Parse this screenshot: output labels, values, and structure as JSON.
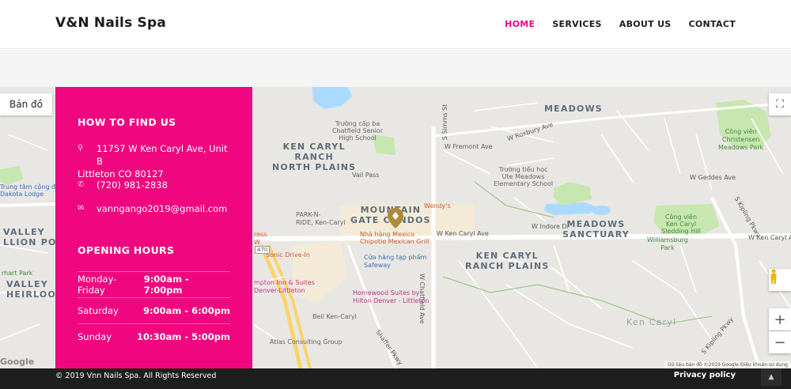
{
  "brand": "V&N Nails Spa",
  "nav": {
    "items": [
      "HOME",
      "SERVICES",
      "ABOUT US",
      "CONTACT"
    ]
  },
  "find": {
    "title": "HOW TO FIND US",
    "address_line1": "11757 W Ken Caryl Ave, Unit B",
    "address_line2": "Littleton CO 80127",
    "phone": "(720) 981-2838",
    "email": "vanngango2019@gmail.com"
  },
  "hours": {
    "title": "OPENING HOURS",
    "rows": [
      {
        "day": "Monday-Friday",
        "time": "9:00am - 7:00pm"
      },
      {
        "day": "Saturday",
        "time": "9:00am - 6:00pm"
      },
      {
        "day": "Sunday",
        "time": "10:30am - 5:00pm"
      }
    ]
  },
  "map": {
    "type_button": "Bản đồ",
    "areas": {
      "meadows": "MEADOWS",
      "ken_caryl_north_1": "KEN CARYL",
      "ken_caryl_north_2": "RANCH",
      "ken_caryl_north_3": "NORTH PLAINS",
      "mountain_gate_1": "MOUNTAIN",
      "mountain_gate_2": "GATE CONDOS",
      "meadows_sanctuary_1": "MEADOWS",
      "meadows_sanctuary_2": "SANCTUARY",
      "ranch_plains_1": "KEN CARYL",
      "ranch_plains_2": "RANCH PLAINS",
      "valley_lion_1": "VALLEY",
      "valley_lion_2": "LLION POIN",
      "valley_heirloom_1": "VALLEY",
      "valley_heirloom_2": "HEIRLOOM",
      "ken_caryl_faint": "Ken Caryl"
    },
    "pois": {
      "school_high_1": "Trường cấp ba",
      "school_high_2": "Chatfield Senior",
      "school_high_3": "High School",
      "school_elem_1": "Trường tiểu học",
      "school_elem_2": "Ute Meadows",
      "school_elem_3": "Elementary School",
      "park_christensen_1": "Công viên",
      "park_christensen_2": "Christensen",
      "park_christensen_3": "Meadows Park",
      "park_sledding_1": "Công viên",
      "park_sledding_2": "Ken Caryl",
      "park_sledding_3": "Sledding Hill",
      "williamsburg_1": "Williamsburg",
      "williamsburg_2": "Park",
      "wendys": "Wendy's",
      "park_n_ride_1": "PARK-N-",
      "park_n_ride_2": "RIDE, Ken-Caryl",
      "nha_hang_1": "Nhà hàng Mexico",
      "nha_hang_2": "Chipotle Mexican Grill",
      "sonic": "Sonic Drive-In",
      "cua_hang_1": "Cửa hàng tạp phẩm",
      "cua_hang_2": "Safeway",
      "hampton_1": "mpton Inn & Suites",
      "hampton_2": "Denver-Littleton",
      "homewood_1": "Homewood Suites by",
      "homewood_2": "Hilton Denver - Littleton",
      "bell": "Bell Ken-Caryl",
      "atlas": "Atlas Consulting Group",
      "express": "ress",
      "express_2": "W",
      "trung_tam_1": "Trung tâm cộng đ",
      "trung_tam_2": "Dakota Lodge",
      "rhart": "rhart Park"
    },
    "streets": {
      "w_ken_caryl_ave_1": "W Ken Caryl Ave",
      "w_ken_caryl_ave_2": "W Ken Caryl Ave",
      "w_chatfield_ave": "W Chatfield Ave",
      "w_fremont_ave": "W Fremont Ave",
      "w_roxbury_ave": "W Roxbury Ave",
      "w_geddes_ave": "W Geddes Ave",
      "s_kipling_pkwy": "S Kipling Pkwy",
      "s_kipling_pkwy_2": "S Kipling Pkwy",
      "s_simms_st": "S Simms St",
      "vail_pass": "Vail Pass",
      "w_indore_dr": "W Indore Dr",
      "shaffer_pkwy": "Shaffer Pkwy",
      "route_470": "470"
    },
    "attribution": "Dữ liệu bản đồ ©2019 Google    Điều khoản sử dụng",
    "google": "Google",
    "zoom_in": "+",
    "zoom_out": "−",
    "fullscreen": "⛶"
  },
  "footer": {
    "copyright": "© 2019 Vnn Nails Spa. All Rights Reserved",
    "privacy": "Privacy policy"
  },
  "colors": {
    "accent": "#f0077f",
    "footer": "#1e1e1e"
  }
}
